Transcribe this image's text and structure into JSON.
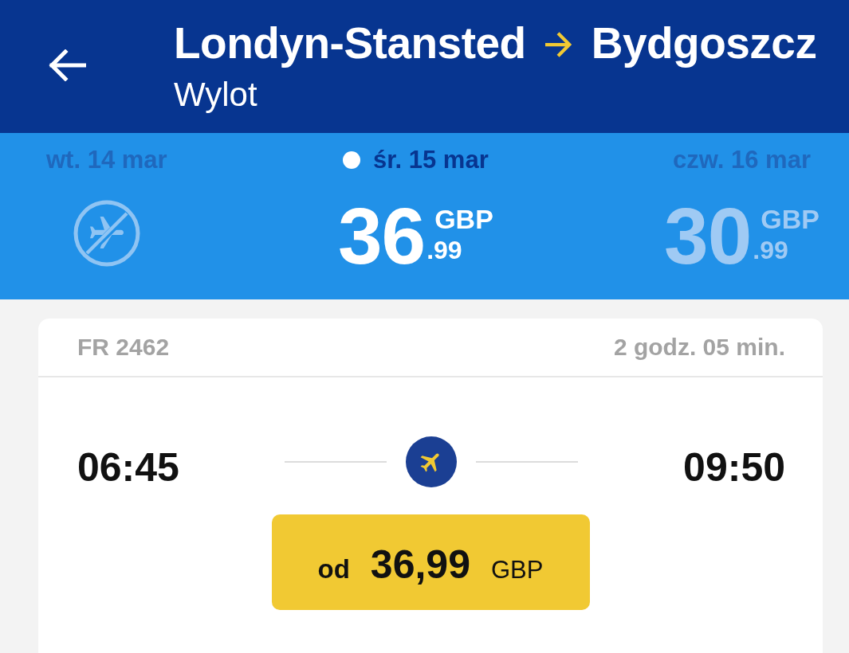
{
  "header": {
    "origin": "Londyn-Stansted",
    "destination": "Bydgoszcz",
    "subtitle": "Wylot"
  },
  "dates": [
    {
      "label": "wt. 14 mar",
      "selected": false,
      "kind": "no-flights"
    },
    {
      "label": "śr. 15 mar",
      "selected": true,
      "kind": "price",
      "price": "36",
      "currency": "GBP",
      "decimals": ".99"
    },
    {
      "label": "czw. 16 mar",
      "selected": false,
      "kind": "price",
      "price": "30",
      "currency": "GBP",
      "decimals": ".99"
    }
  ],
  "flight": {
    "number": "FR 2462",
    "duration": "2 godz. 05 min.",
    "departure": "06:45",
    "arrival": "09:50",
    "fare": {
      "prefix": "od",
      "amount": "36,99",
      "currency": "GBP"
    }
  }
}
